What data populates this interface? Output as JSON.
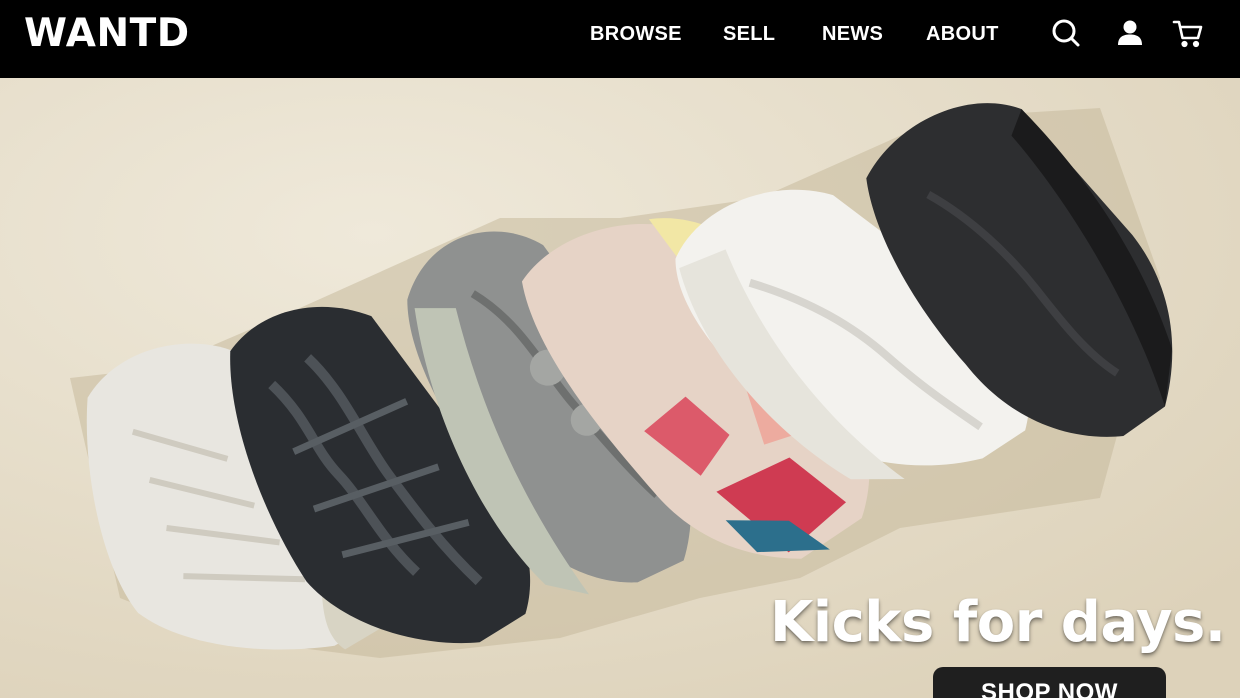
{
  "header": {
    "logo": "WANTD",
    "nav": [
      {
        "label": "BROWSE"
      },
      {
        "label": "SELL"
      },
      {
        "label": "NEWS"
      },
      {
        "label": "ABOUT"
      }
    ],
    "icons": [
      "search-icon",
      "account-icon",
      "cart-icon"
    ]
  },
  "hero": {
    "headline": "Kicks for days.",
    "cta_label": "SHOP NOW",
    "image_content": "row of sneakers laid diagonally on beige background"
  },
  "colors": {
    "header_bg": "#000000",
    "hero_bg": "#e9e0cf",
    "button_bg": "#1f1f1f",
    "text": "#ffffff"
  }
}
